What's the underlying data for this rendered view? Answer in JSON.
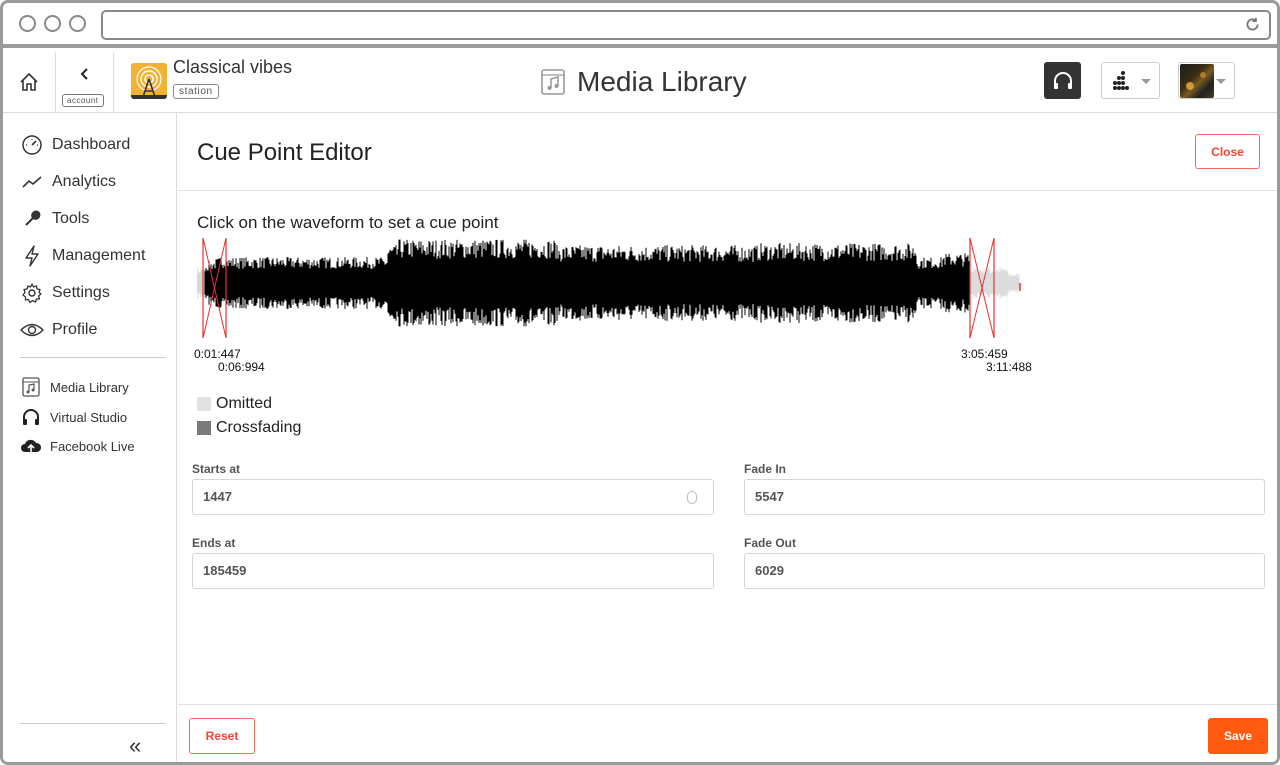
{
  "header": {
    "account_label": "account",
    "station_name": "Classical vibes",
    "station_tag": "station",
    "page_title": "Media Library"
  },
  "sidebar": {
    "items": [
      {
        "label": "Dashboard",
        "icon": "gauge-icon"
      },
      {
        "label": "Analytics",
        "icon": "trend-line-icon"
      },
      {
        "label": "Tools",
        "icon": "wrench-icon"
      },
      {
        "label": "Management",
        "icon": "lightning-icon"
      },
      {
        "label": "Settings",
        "icon": "gear-icon"
      },
      {
        "label": "Profile",
        "icon": "eye-icon"
      }
    ],
    "sub_items": [
      {
        "label": "Media Library",
        "icon": "music-file-icon"
      },
      {
        "label": "Virtual Studio",
        "icon": "headphones-icon"
      },
      {
        "label": "Facebook Live",
        "icon": "cloud-upload-icon"
      }
    ],
    "collapse_glyph": "«"
  },
  "editor": {
    "title": "Cue Point Editor",
    "close_label": "Close",
    "instruction": "Click on the waveform to set a cue point",
    "times": {
      "start": "0:01:447",
      "fade_in_end": "0:06:994",
      "fade_out_start": "3:05:459",
      "end": "3:11:488"
    },
    "legend": [
      {
        "label": "Omitted",
        "color": "#e2e2e2"
      },
      {
        "label": "Crossfading",
        "color": "#7a7a7a"
      }
    ],
    "fields": {
      "starts_at": {
        "label": "Starts at",
        "value": "1447"
      },
      "ends_at": {
        "label": "Ends at",
        "value": "185459"
      },
      "fade_in": {
        "label": "Fade In",
        "value": "5547"
      },
      "fade_out": {
        "label": "Fade Out",
        "value": "6029"
      }
    },
    "reset_label": "Reset",
    "save_label": "Save"
  },
  "colors": {
    "accent": "#ff5a10",
    "cue_marker": "#e8322a",
    "waveform": "#000000"
  }
}
